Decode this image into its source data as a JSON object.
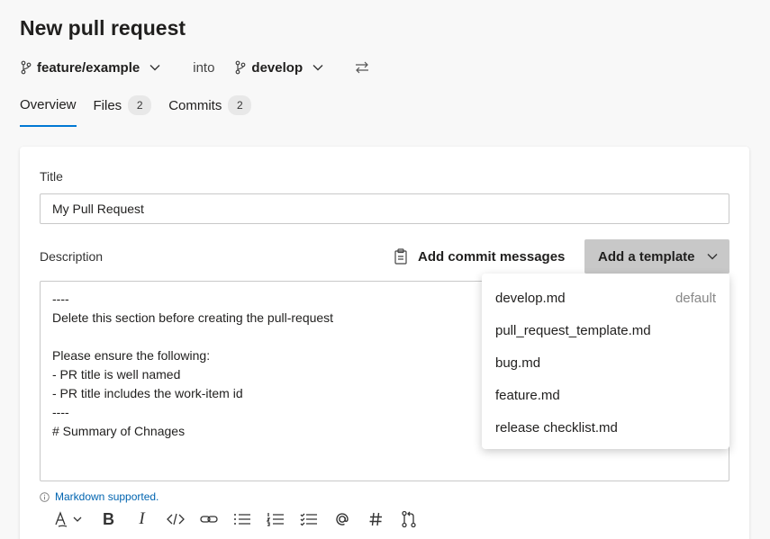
{
  "page": {
    "title": "New pull request"
  },
  "branches": {
    "source": "feature/example",
    "connector": "into",
    "target": "develop"
  },
  "tabs": [
    {
      "label": "Overview"
    },
    {
      "label": "Files",
      "count": "2"
    },
    {
      "label": "Commits",
      "count": "2"
    }
  ],
  "form": {
    "title_label": "Title",
    "title_value": "My Pull Request",
    "description_label": "Description",
    "add_commit_messages": "Add commit messages",
    "add_template": "Add a template",
    "description_text": "----\nDelete this section before creating the pull-request\n\nPlease ensure the following:\n- PR title is well named\n- PR title includes the work-item id\n----\n# Summary of Chnages",
    "markdown_note": "Markdown supported."
  },
  "template_menu": [
    {
      "name": "develop.md",
      "tag": "default"
    },
    {
      "name": "pull_request_template.md",
      "tag": ""
    },
    {
      "name": "bug.md",
      "tag": ""
    },
    {
      "name": "feature.md",
      "tag": ""
    },
    {
      "name": "release checklist.md",
      "tag": ""
    }
  ],
  "toolbar_icons": [
    "format-icon",
    "bold-icon",
    "italic-icon",
    "code-icon",
    "link-icon",
    "bulleted-list-icon",
    "numbered-list-icon",
    "checklist-icon",
    "mention-icon",
    "hashtag-icon",
    "pull-request-icon"
  ],
  "colors": {
    "accent": "#0078d4",
    "link": "#0064b0",
    "button_bg": "#c8c8c8"
  }
}
